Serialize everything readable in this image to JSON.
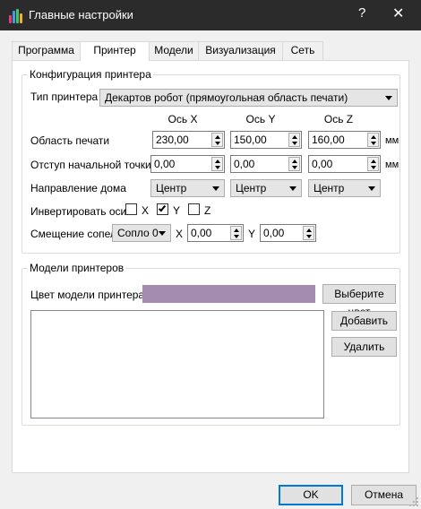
{
  "window": {
    "title": "Главные настройки",
    "help_label": "?",
    "close_label": "✕",
    "icon": "app-logo-icon"
  },
  "tabs": [
    {
      "label": "Программа",
      "active": false
    },
    {
      "label": "Принтер",
      "active": true
    },
    {
      "label": "Модели",
      "active": false
    },
    {
      "label": "Визуализация",
      "active": false
    },
    {
      "label": "Сеть",
      "active": false
    }
  ],
  "config": {
    "title": "Конфигурация принтера",
    "printer_type_label": "Тип принтера",
    "printer_type_value": "Декартов робот (прямоугольная область печати)",
    "axes": {
      "x": "Ось X",
      "y": "Ось Y",
      "z": "Ось Z"
    },
    "print_area_label": "Область печати",
    "print_area": {
      "x": "230,00",
      "y": "150,00",
      "z": "160,00"
    },
    "offset_label": "Отступ начальной точки",
    "offset": {
      "x": "0,00",
      "y": "0,00",
      "z": "0,00"
    },
    "unit": "мм",
    "home_dir_label": "Направление дома",
    "home_dir": {
      "x": "Центр",
      "y": "Центр",
      "z": "Центр"
    },
    "invert_label": "Инвертировать оси",
    "invert": {
      "x": {
        "label": "X",
        "checked": false
      },
      "y": {
        "label": "Y",
        "checked": true
      },
      "z": {
        "label": "Z",
        "checked": false
      }
    },
    "nozzle_label": "Смещение сопел",
    "nozzle_value": "Сопло 0",
    "nozzle_x_label": "X",
    "nozzle_x": "0,00",
    "nozzle_y_label": "Y",
    "nozzle_y": "0,00"
  },
  "models": {
    "title": "Модели принтеров",
    "color_label": "Цвет модели принтера",
    "color": "#a48cb0",
    "choose_color_button": "Выберите цвет",
    "add_button": "Добавить",
    "delete_button": "Удалить"
  },
  "footer": {
    "ok": "OK",
    "cancel": "Отмена"
  }
}
